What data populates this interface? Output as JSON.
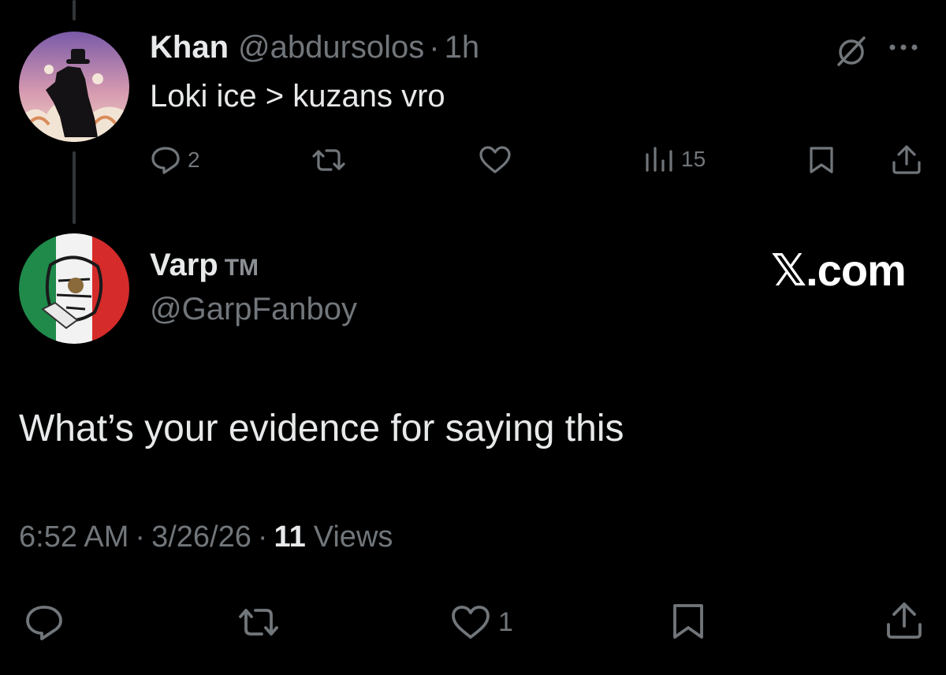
{
  "parent_tweet": {
    "name": "Khan",
    "handle": "@abdursolos",
    "separator": "·",
    "time": "1h",
    "text": "Loki ice > kuzans vro",
    "reply_count": "2",
    "retweet_count": "",
    "like_count": "",
    "views_count": "15",
    "icons": [
      "grok-icon",
      "more-icon",
      "reply-icon",
      "retweet-icon",
      "like-icon",
      "views-icon",
      "bookmark-icon",
      "share-icon"
    ]
  },
  "reply_tweet": {
    "name": "Varp",
    "badge": "TM",
    "handle": "@GarpFanboy",
    "text": "What’s your evidence for saying this",
    "time": "6:52 AM",
    "date": "3/26/26",
    "separator": "·",
    "views_count": "11",
    "views_label": "Views",
    "reply_count": "",
    "retweet_count": "",
    "like_count": "1",
    "icons": [
      "reply-icon",
      "retweet-icon",
      "like-icon",
      "bookmark-icon",
      "share-icon"
    ]
  },
  "watermark": "𝕏.com",
  "colors": {
    "background": "#000000",
    "text_primary": "#e7e9ea",
    "text_secondary": "#71767b",
    "thread_line": "#333639"
  }
}
